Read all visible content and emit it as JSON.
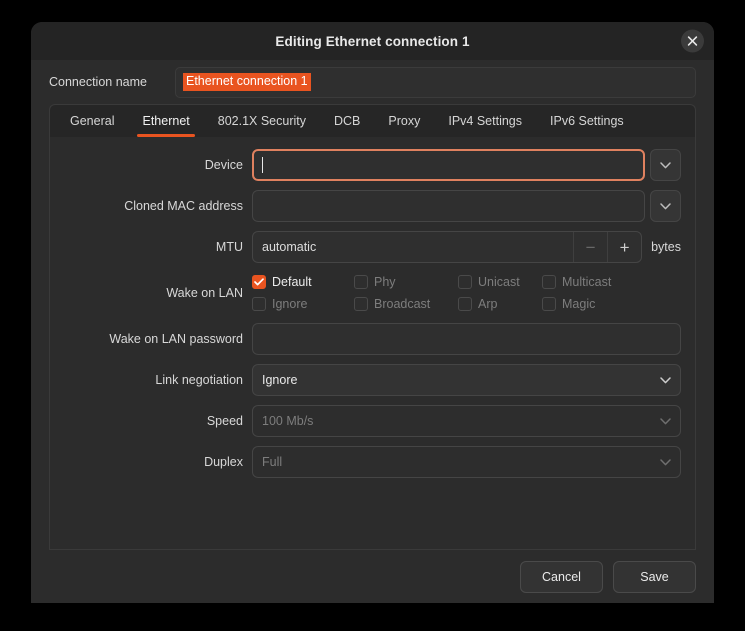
{
  "window": {
    "title": "Editing Ethernet connection 1",
    "close_icon": "close-icon"
  },
  "connection": {
    "label": "Connection name",
    "value": "Ethernet connection 1"
  },
  "tabs": [
    {
      "label": "General",
      "active": false
    },
    {
      "label": "Ethernet",
      "active": true
    },
    {
      "label": "802.1X Security",
      "active": false
    },
    {
      "label": "DCB",
      "active": false
    },
    {
      "label": "Proxy",
      "active": false
    },
    {
      "label": "IPv4 Settings",
      "active": false
    },
    {
      "label": "IPv6 Settings",
      "active": false
    }
  ],
  "form": {
    "device": {
      "label": "Device",
      "value": "",
      "placeholder": ""
    },
    "cloned_mac": {
      "label": "Cloned MAC address",
      "value": "",
      "placeholder": ""
    },
    "mtu": {
      "label": "MTU",
      "value": "automatic",
      "unit": "bytes",
      "minus": "−",
      "plus": "+"
    },
    "wake_on_lan": {
      "label": "Wake on LAN",
      "options": [
        {
          "label": "Default",
          "checked": true,
          "enabled": true
        },
        {
          "label": "Phy",
          "checked": false,
          "enabled": false
        },
        {
          "label": "Unicast",
          "checked": false,
          "enabled": false
        },
        {
          "label": "Multicast",
          "checked": false,
          "enabled": false
        },
        {
          "label": "Ignore",
          "checked": false,
          "enabled": false
        },
        {
          "label": "Broadcast",
          "checked": false,
          "enabled": false
        },
        {
          "label": "Arp",
          "checked": false,
          "enabled": false
        },
        {
          "label": "Magic",
          "checked": false,
          "enabled": false
        }
      ]
    },
    "wol_password": {
      "label": "Wake on LAN password",
      "value": ""
    },
    "link_negotiation": {
      "label": "Link negotiation",
      "value": "Ignore",
      "enabled": true
    },
    "speed": {
      "label": "Speed",
      "value": "100 Mb/s",
      "enabled": false
    },
    "duplex": {
      "label": "Duplex",
      "value": "Full",
      "enabled": false
    }
  },
  "footer": {
    "cancel_label": "Cancel",
    "save_label": "Save"
  },
  "colors": {
    "accent": "#e95420",
    "window_bg": "#2c2c2c",
    "titlebar_bg": "#242424"
  }
}
